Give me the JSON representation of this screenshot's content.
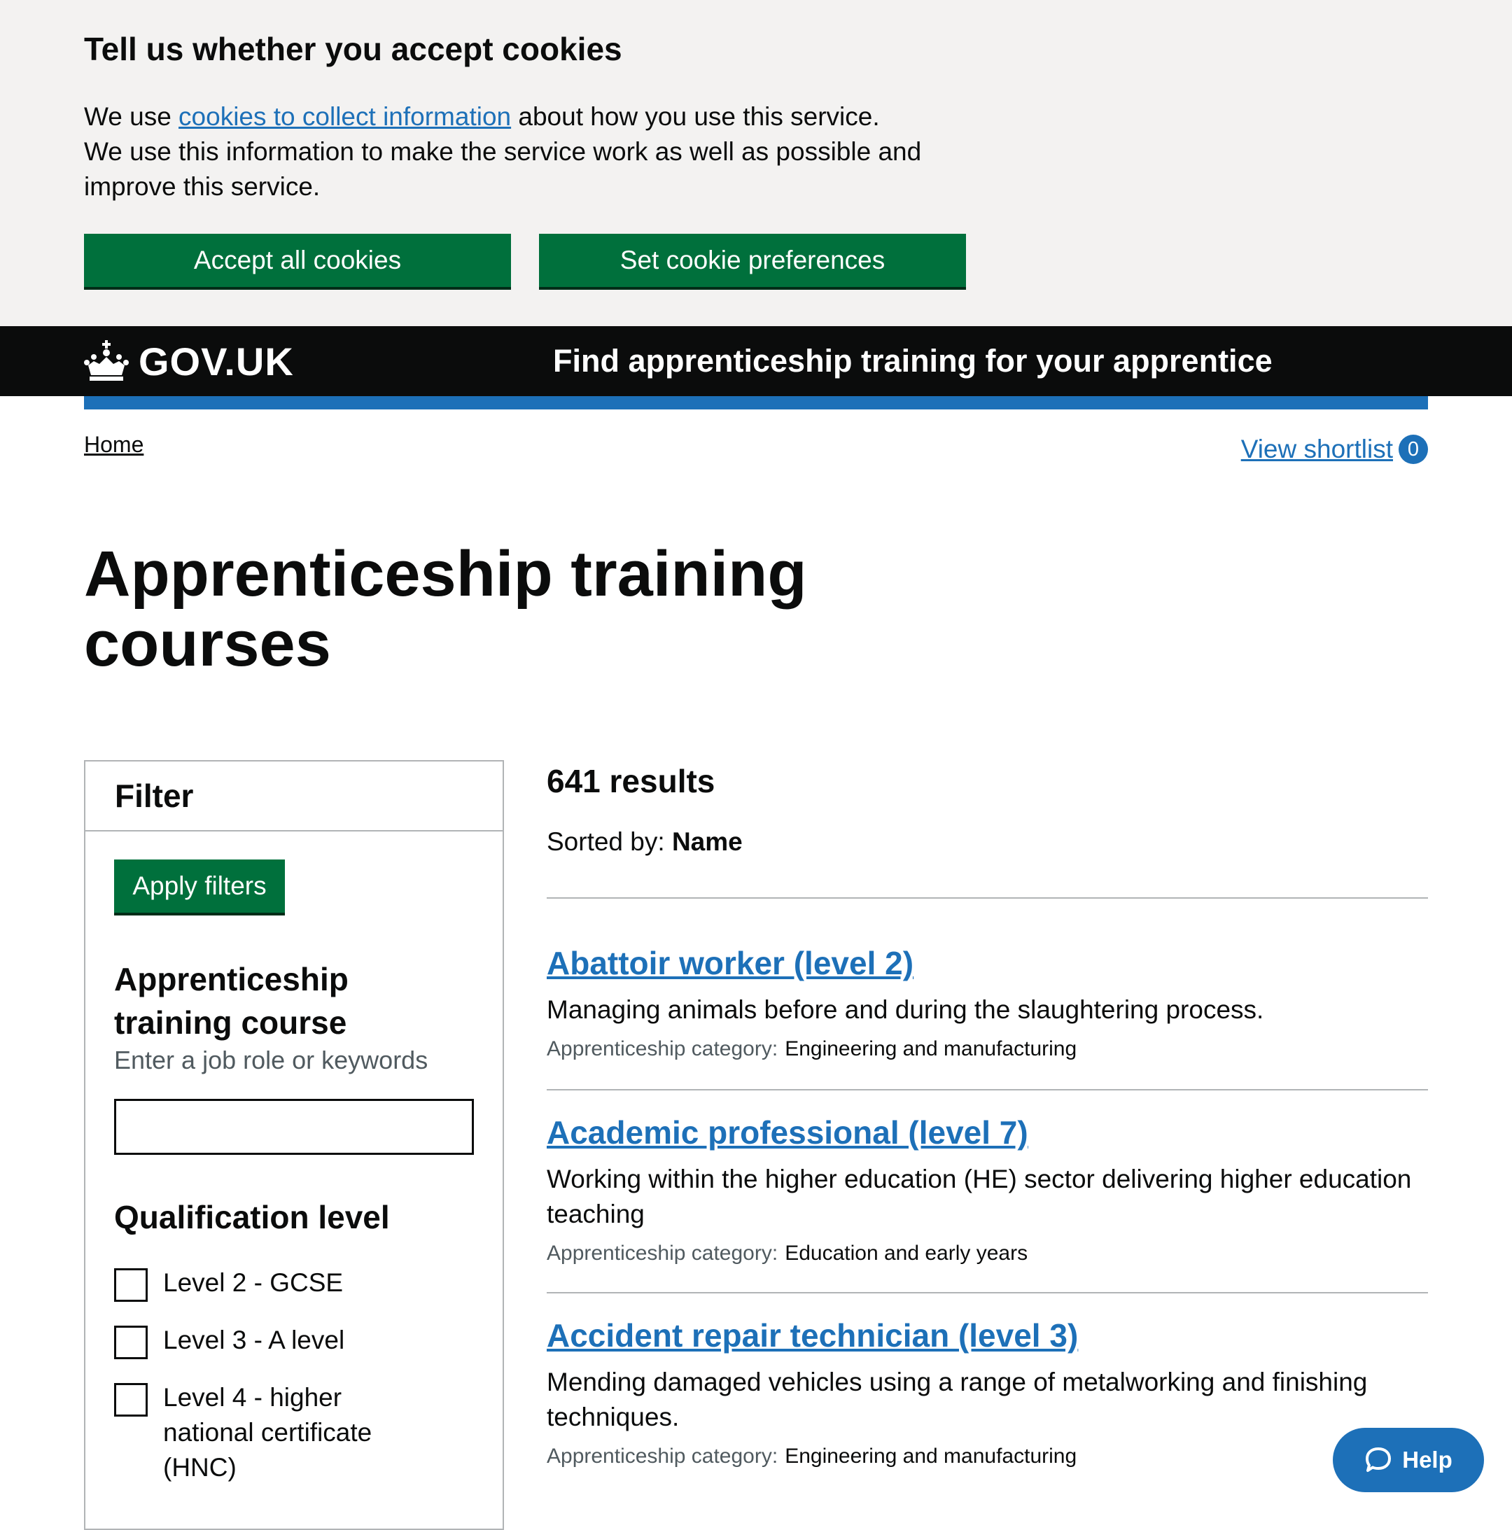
{
  "cookie_banner": {
    "title": "Tell us whether you accept cookies",
    "text_before": "We use ",
    "link_text": "cookies to collect information",
    "text_after": " about how you use this service. We use this information to make the service work as well as possible and improve this service.",
    "accept_label": "Accept all cookies",
    "preferences_label": "Set cookie preferences"
  },
  "header": {
    "logo_text": "GOV.UK",
    "service_name": "Find apprenticeship training for your apprentice"
  },
  "breadcrumb": {
    "home": "Home"
  },
  "shortlist": {
    "label": "View shortlist",
    "count": "0"
  },
  "page": {
    "title": "Apprenticeship training courses"
  },
  "filter": {
    "title": "Filter",
    "apply_label": "Apply filters",
    "course_title": "Apprenticeship training course",
    "course_hint": "Enter a job role or keywords",
    "course_value": "",
    "qualification_title": "Qualification level",
    "levels": [
      {
        "label": "Level 2 - GCSE",
        "checked": false
      },
      {
        "label": "Level 3 - A level",
        "checked": false
      },
      {
        "label": "Level 4 - higher national certificate (HNC)",
        "checked": false
      }
    ]
  },
  "results": {
    "count": "641 results",
    "sorted_label": "Sorted by:",
    "sorted_value": "Name",
    "category_label": "Apprenticeship category:",
    "items": [
      {
        "title": "Abattoir worker (level 2)",
        "description": "Managing animals before and during the slaughtering process.",
        "category": "Engineering and manufacturing"
      },
      {
        "title": "Academic professional (level 7)",
        "description": "Working within the higher education (HE) sector delivering higher education teaching",
        "category": "Education and early years"
      },
      {
        "title": "Accident repair technician (level 3)",
        "description": "Mending damaged vehicles using a range of metalworking and finishing techniques.",
        "category": "Engineering and manufacturing"
      }
    ]
  },
  "help": {
    "label": "Help"
  },
  "colors": {
    "govuk_blue": "#1d70b8",
    "button_green": "#00703c",
    "header_black": "#0b0c0c",
    "banner_grey": "#f3f2f1"
  }
}
